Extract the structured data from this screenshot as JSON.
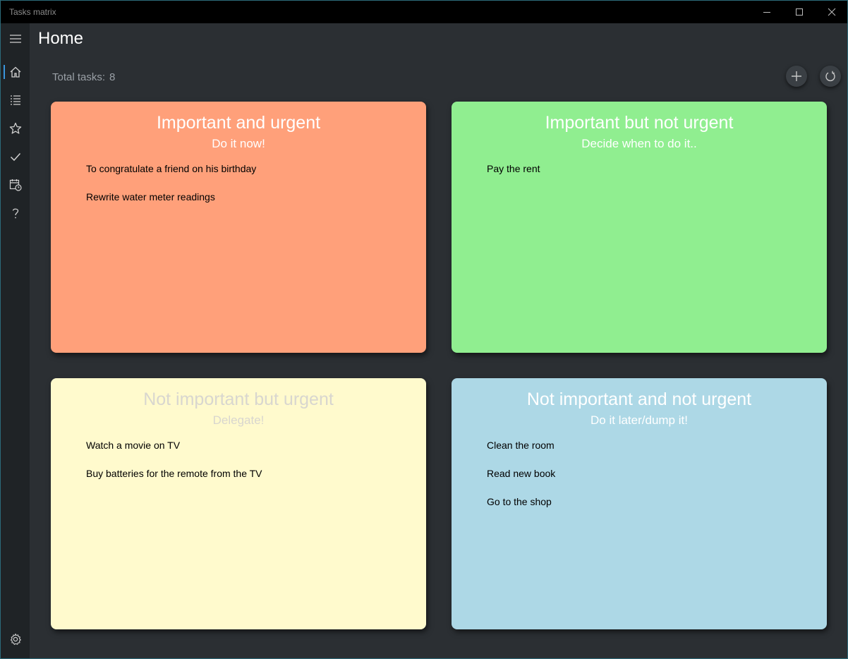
{
  "window": {
    "title": "Tasks matrix"
  },
  "nav": {
    "items": [
      {
        "icon": "home-icon",
        "selected": true
      },
      {
        "icon": "list-icon",
        "selected": false
      },
      {
        "icon": "star-icon",
        "selected": false
      },
      {
        "icon": "checkmark-icon",
        "selected": false
      },
      {
        "icon": "calendar-clock-icon",
        "selected": false
      },
      {
        "icon": "help-icon",
        "selected": false
      }
    ],
    "settings_icon": "gear-icon"
  },
  "header": {
    "title": "Home",
    "total_label": "Total tasks:",
    "total_value": "8"
  },
  "quadrants": [
    {
      "title": "Important and urgent",
      "subtitle": "Do it now!",
      "color": "#ffa07a",
      "tasks": [
        "To congratulate a friend on his birthday",
        "Rewrite water meter readings"
      ]
    },
    {
      "title": "Important but not urgent",
      "subtitle": "Decide when to do it..",
      "color": "#90ee90",
      "tasks": [
        "Pay the rent"
      ]
    },
    {
      "title": "Not important but urgent",
      "subtitle": "Delegate!",
      "color": "#fffacd",
      "tasks": [
        "Watch a movie on TV",
        "Buy batteries for the remote from the TV"
      ]
    },
    {
      "title": "Not important and not urgent",
      "subtitle": "Do it later/dump it!",
      "color": "#add8e6",
      "tasks": [
        "Clean the room",
        "Read new book",
        "Go to the shop"
      ]
    }
  ]
}
